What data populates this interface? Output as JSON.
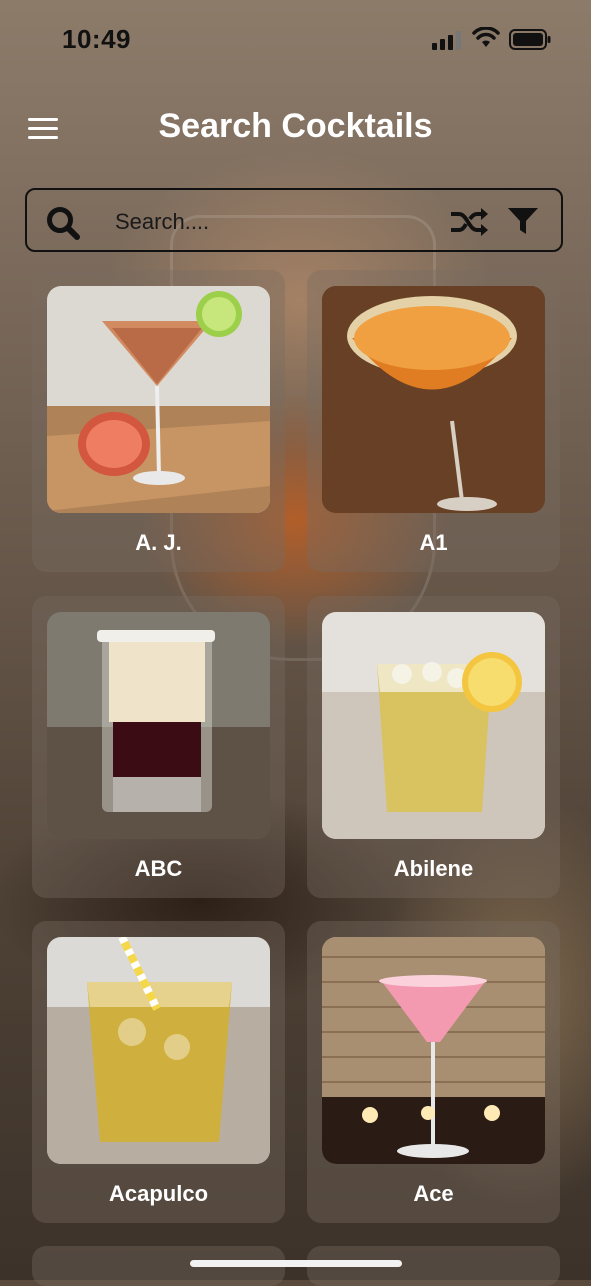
{
  "status_bar": {
    "time": "10:49"
  },
  "header": {
    "title": "Search Cocktails"
  },
  "search": {
    "placeholder": "Search...."
  },
  "cocktails": [
    {
      "name": "A. J."
    },
    {
      "name": "A1"
    },
    {
      "name": "ABC"
    },
    {
      "name": "Abilene"
    },
    {
      "name": "Acapulco"
    },
    {
      "name": "Ace"
    }
  ]
}
